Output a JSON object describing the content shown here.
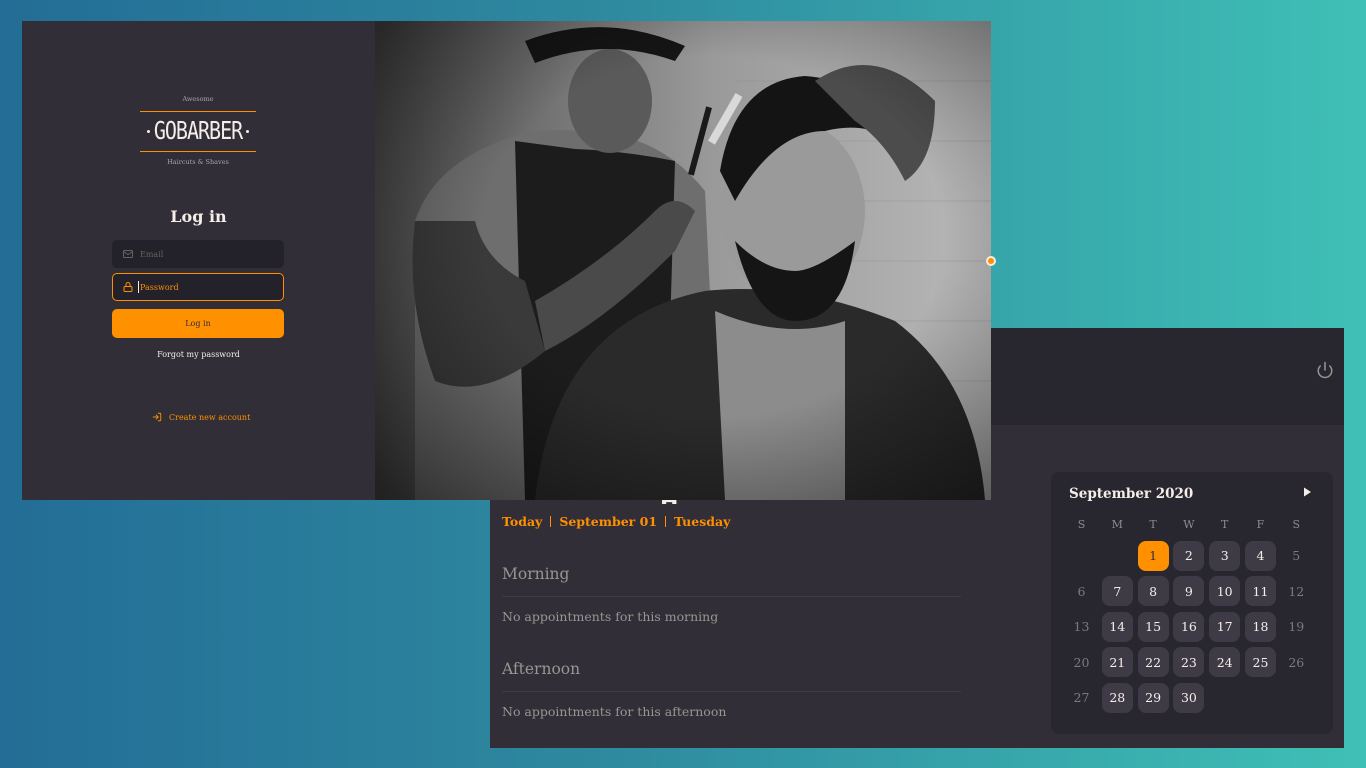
{
  "dashboard": {
    "date_parts": [
      "Today",
      "September 01",
      "Tuesday"
    ],
    "morning": {
      "title": "Morning",
      "empty": "No appointments for this morning"
    },
    "afternoon": {
      "title": "Afternoon",
      "empty": "No appointments for this afternoon"
    },
    "power_icon": "power-icon",
    "calendar": {
      "month_label": "September 2020",
      "weekdays": [
        "S",
        "M",
        "T",
        "W",
        "T",
        "F",
        "S"
      ],
      "leading_blanks": 2,
      "days": [
        1,
        2,
        3,
        4,
        5,
        6,
        7,
        8,
        9,
        10,
        11,
        12,
        13,
        14,
        15,
        16,
        17,
        18,
        19,
        20,
        21,
        22,
        23,
        24,
        25,
        26,
        27,
        28,
        29,
        30
      ],
      "selected_day": 1,
      "disabled_weekdays": [
        0,
        6
      ],
      "next_icon": "play-right-icon"
    }
  },
  "login": {
    "logo": {
      "top": "Awesome",
      "main": "GOBARBER",
      "sub": "Haircuts & Shaves"
    },
    "title": "Log in",
    "email_placeholder": "Email",
    "password_placeholder": "Password",
    "submit_label": "Log in",
    "forgot_label": "Forgot my password",
    "create_label": "Create new account"
  },
  "colors": {
    "accent": "#ff9000",
    "background": "#312e38",
    "input": "#232129",
    "text": "#f4ede8"
  }
}
